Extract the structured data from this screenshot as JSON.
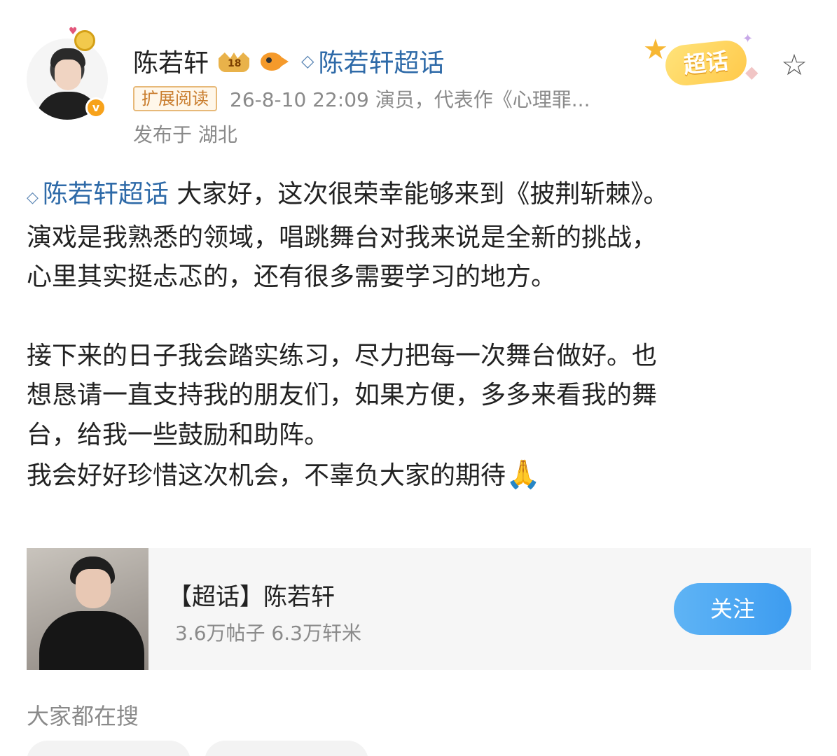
{
  "post": {
    "author_name": "陈若轩",
    "topic_link": "陈若轩超话",
    "expand_tag": "扩展阅读",
    "meta": "26-8-10 22:09  演员，代表作《心理罪...",
    "location": "发布于 湖北",
    "super_badge": "超话",
    "badge_icon": "v-verified-icon",
    "content": {
      "topic_inline": "陈若轩超话",
      "line1_rest": " 大家好，这次很荣幸能够来到《披荆斩棘》。",
      "line2": "演戏是我熟悉的领域，唱跳舞台对我来说是全新的挑战，",
      "line3": "心里其实挺忐忑的，还有很多需要学习的地方。",
      "line4": "接下来的日子我会踏实练习，尽力把每一次舞台做好。也",
      "line5": "想恳请一直支持我的朋友们，如果方便，多多来看我的舞",
      "line6": "台，给我一些鼓励和助阵。",
      "line7": "我会好好珍惜这次机会，不辜负大家的期待",
      "emoji": "🙏"
    }
  },
  "card": {
    "title": "【超话】陈若轩",
    "stats": "3.6万帖子 6.3万轩米",
    "follow_label": "关注"
  },
  "search": {
    "title": "大家都在搜"
  },
  "colors": {
    "link": "#2e6aa8",
    "follow_button": "#3d9cf0",
    "meta_gray": "#8a8a8a"
  }
}
